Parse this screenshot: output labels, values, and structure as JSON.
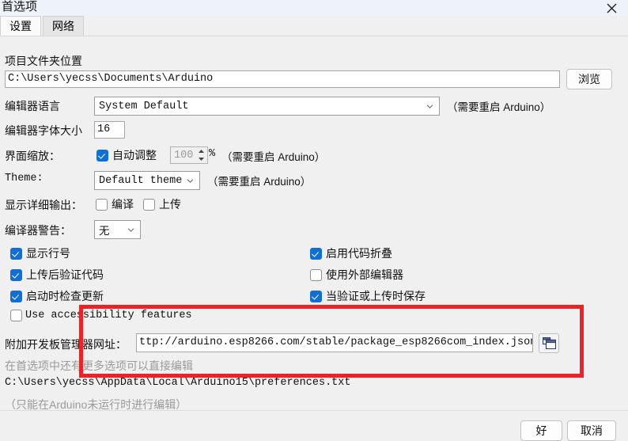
{
  "window": {
    "title": "首选项",
    "close_icon": "close-icon"
  },
  "tabs": [
    {
      "label": "设置",
      "active": true
    },
    {
      "label": "网络",
      "active": false
    }
  ],
  "settings": {
    "sketchbook": {
      "label": "项目文件夹位置",
      "value": "C:\\Users\\yecss\\Documents\\Arduino",
      "browse_label": "浏览"
    },
    "editor_language": {
      "label": "编辑器语言",
      "value": "System Default",
      "note": "（需要重启 Arduino）"
    },
    "editor_font_size": {
      "label": "编辑器字体大小",
      "value": "16"
    },
    "interface_scale": {
      "label": "界面缩放：",
      "auto_label": "自动调整",
      "auto_checked": true,
      "percent_value": "100",
      "percent_sign": "%",
      "note": "（需要重启 Arduino）"
    },
    "theme": {
      "label": "Theme:",
      "value": "Default theme",
      "note": "（需要重启 Arduino）"
    },
    "verbose_output": {
      "label": "显示详细输出：",
      "compile_label": "编译",
      "compile_checked": false,
      "upload_label": "上传",
      "upload_checked": false
    },
    "compiler_warnings": {
      "label": "编译器警告：",
      "value": "无"
    },
    "checkboxes_left": [
      {
        "label": "显示行号",
        "checked": true,
        "mono": false
      },
      {
        "label": "上传后验证代码",
        "checked": true,
        "mono": false
      },
      {
        "label": "启动时检查更新",
        "checked": true,
        "mono": false
      },
      {
        "label": "Use accessibility features",
        "checked": false,
        "mono": true
      }
    ],
    "checkboxes_right": [
      {
        "label": "启用代码折叠",
        "checked": true
      },
      {
        "label": "使用外部编辑器",
        "checked": false
      },
      {
        "label": "当验证或上传时保存",
        "checked": true
      }
    ],
    "board_manager_urls": {
      "label": "附加开发板管理器网址：",
      "value": "ttp://arduino.esp8266.com/stable/package_esp8266com_index.json",
      "icon": "cascade-windows-icon"
    },
    "more_prefs_hint": "在首选项中还有更多选项可以直接编辑",
    "prefs_file_path": "C:\\Users\\yecss\\AppData\\Local\\Arduino15\\preferences.txt",
    "prefs_edit_note_prefix": "（只能在 ",
    "prefs_edit_note_app": "Arduino",
    "prefs_edit_note_suffix": " 未运行时进行编辑）"
  },
  "footer": {
    "ok_label": "好",
    "cancel_label": "取消"
  },
  "annotation": {
    "color": "#ec2227",
    "name": "red-highlight-rectangle"
  }
}
